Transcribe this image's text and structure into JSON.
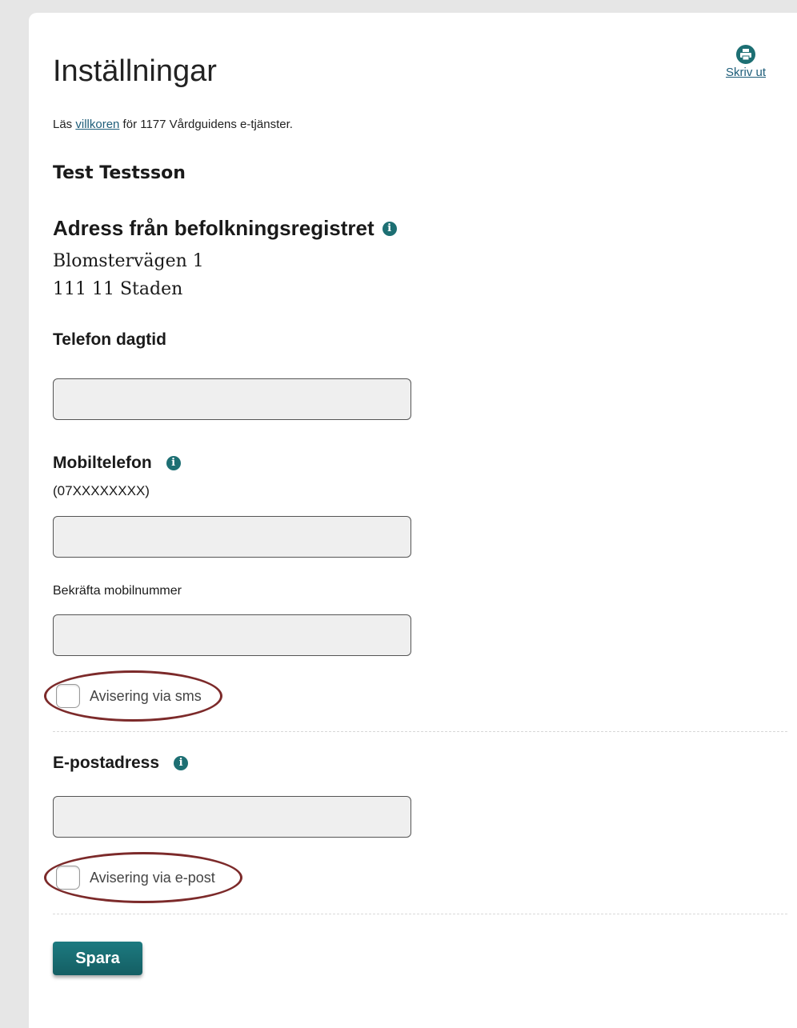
{
  "header": {
    "title": "Inställningar",
    "print_label": "Skriv ut",
    "print_icon": "printer-icon"
  },
  "terms": {
    "prefix": "Läs ",
    "link": "villkoren",
    "suffix": " för 1177 Vårdguidens e-tjänster."
  },
  "user": {
    "name": "Test Testsson"
  },
  "address": {
    "heading": "Adress från befolkningsregistret",
    "line1": "Blomstervägen 1",
    "line2": "111 11 Staden",
    "info_icon": "info-icon"
  },
  "phone_day": {
    "label": "Telefon dagtid",
    "value": ""
  },
  "mobile": {
    "label": "Mobiltelefon",
    "hint": "(07XXXXXXXX)",
    "value": "",
    "confirm_label": "Bekräfta mobilnummer",
    "confirm_value": "",
    "sms_label": "Avisering via sms",
    "sms_checked": false
  },
  "email": {
    "label": "E-postadress",
    "value": "",
    "notify_label": "Avisering via e-post",
    "notify_checked": false
  },
  "actions": {
    "save_label": "Spara"
  },
  "colors": {
    "accent": "#1d6f73",
    "link": "#1f5e7a",
    "highlight": "#7c2a2a",
    "input_bg": "#efefef"
  }
}
